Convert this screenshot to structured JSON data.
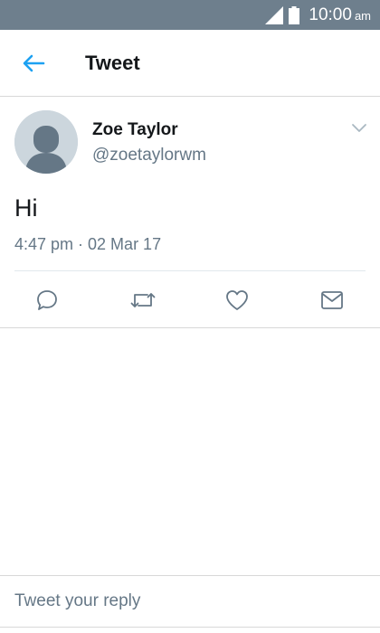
{
  "status_bar": {
    "time": "10:00",
    "ampm": "am",
    "signal_icon": "signal-icon",
    "battery_icon": "battery-icon"
  },
  "app_bar": {
    "back_icon": "back-arrow-icon",
    "title": "Tweet"
  },
  "tweet": {
    "author_name": "Zoe Taylor",
    "author_handle": "@zoetaylorwm",
    "text": "Hi",
    "meta": "4:47 pm · 02 Mar 17",
    "more_icon": "chevron-down-icon"
  },
  "actions": [
    {
      "icon": "reply-icon"
    },
    {
      "icon": "retweet-icon"
    },
    {
      "icon": "like-icon"
    },
    {
      "icon": "message-icon"
    }
  ],
  "reply_bar": {
    "placeholder": "Tweet your reply"
  },
  "colors": {
    "status_bar": "#6e7f8d",
    "accent": "#1da1f2",
    "icon_gray": "#657786",
    "text": "#14171a"
  }
}
